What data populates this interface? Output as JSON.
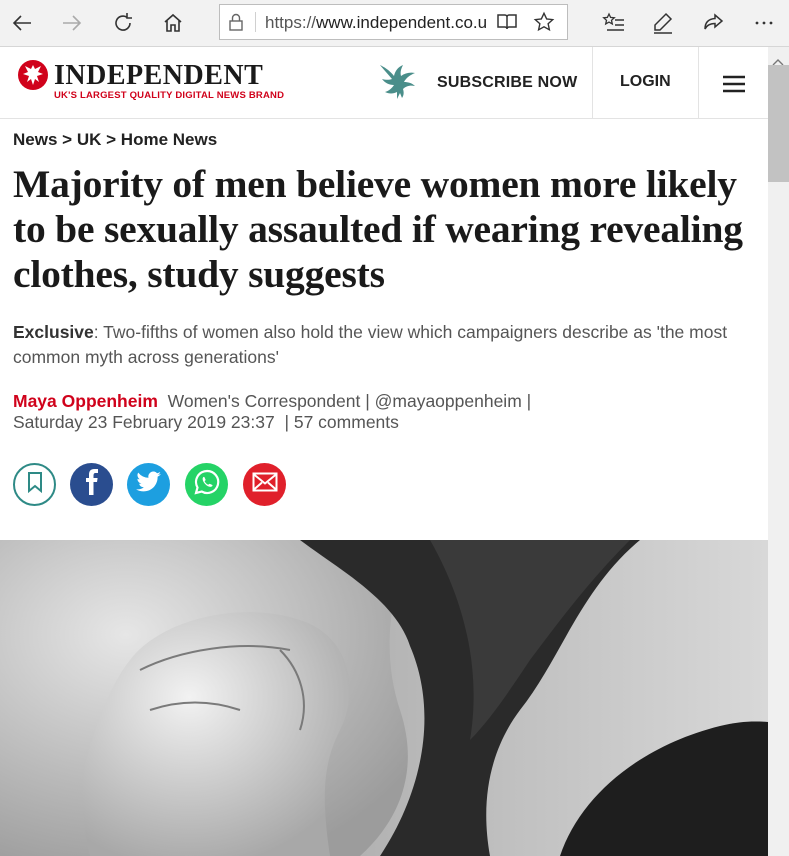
{
  "browser": {
    "url_main": "https://www.independent.co.u",
    "icons": [
      "back-icon",
      "forward-icon",
      "refresh-icon",
      "home-icon",
      "lock-icon",
      "reading-view-icon",
      "favorite-star-icon",
      "favorites-list-icon",
      "pen-icon",
      "share-icon",
      "more-icon"
    ]
  },
  "site": {
    "logo_text": "INDEPENDENT",
    "tagline": "UK'S LARGEST QUALITY DIGITAL NEWS BRAND",
    "subscribe_label": "SUBSCRIBE NOW",
    "login_label": "LOGIN",
    "brand_color": "#d0021b"
  },
  "breadcrumb": {
    "items": [
      "News",
      "UK",
      "Home News"
    ],
    "separator": ">"
  },
  "article": {
    "headline": "Majority of men believe women more likely to be sexually assaulted if wearing revealing clothes, study suggests",
    "standfirst_lead": "Exclusive",
    "standfirst_body": ": Two-fifths of women also hold the view which campaigners describe as 'the most common myth across generations'",
    "author": "Maya Oppenheim",
    "role": "Women's Correspondent",
    "handle": "@mayaoppenheim",
    "date": "Saturday 23 February 2019 23:37",
    "comments": "57 comments"
  },
  "share": {
    "buttons": [
      "bookmark",
      "facebook",
      "twitter",
      "whatsapp",
      "email"
    ],
    "colors": {
      "bookmark": "#2e8a86",
      "facebook": "#2a4d8f",
      "twitter": "#1d9fe0",
      "whatsapp": "#25d366",
      "email": "#e0202b"
    }
  }
}
